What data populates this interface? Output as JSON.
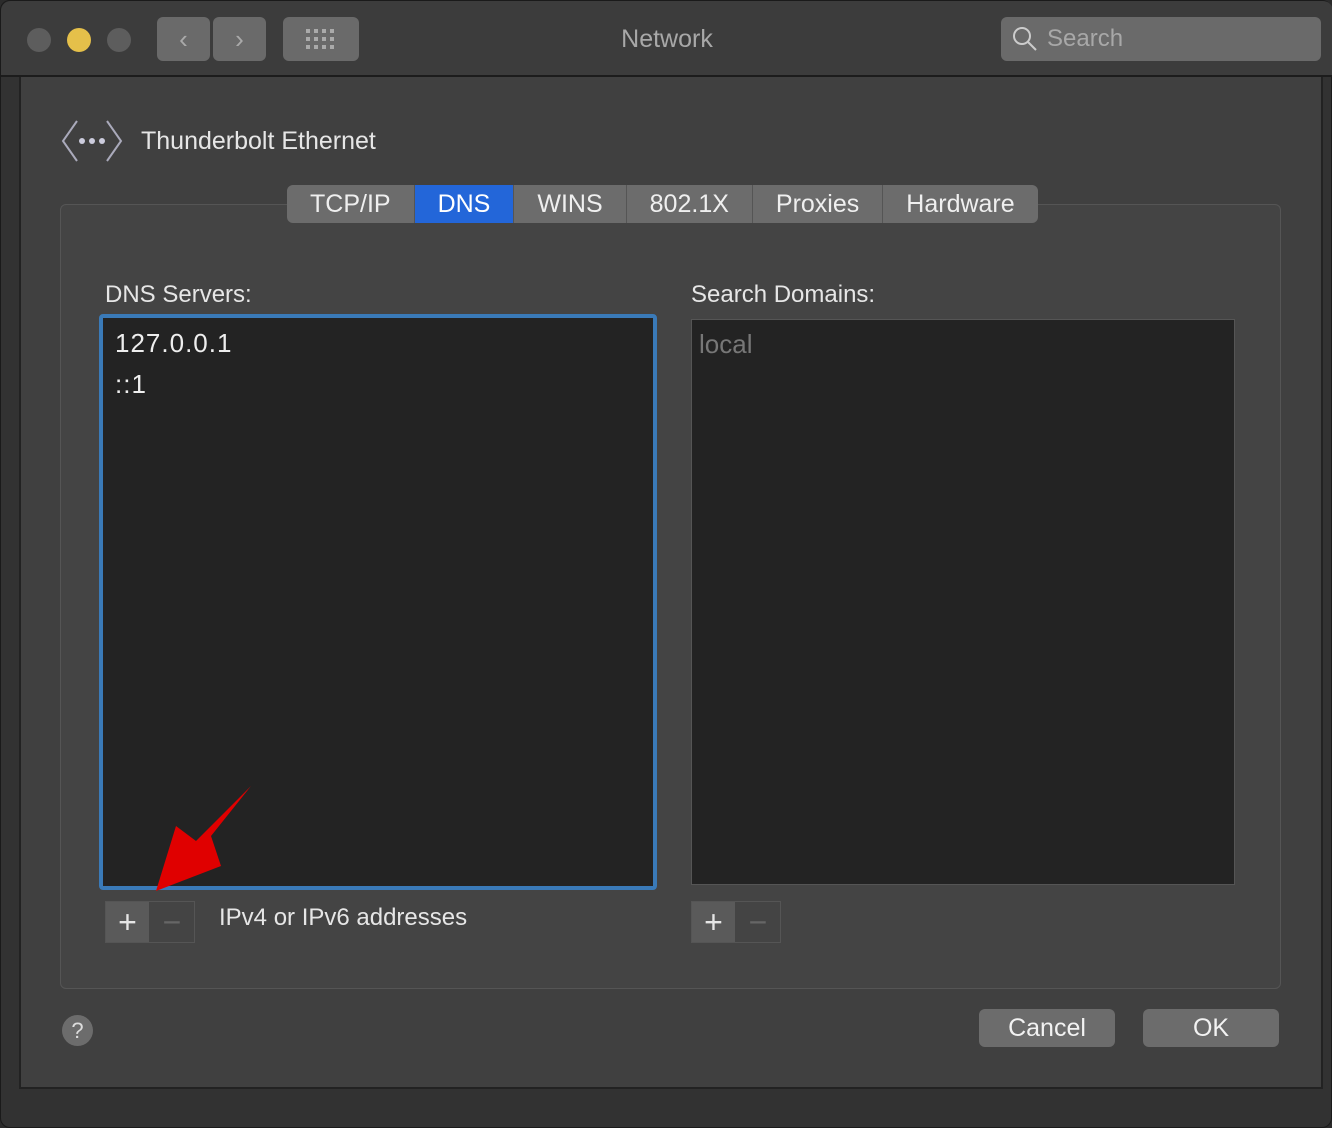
{
  "window": {
    "title": "Network",
    "search_placeholder": "Search"
  },
  "header": {
    "title": "Thunderbolt Ethernet",
    "icon": "network-ethernet-icon"
  },
  "tabs": [
    {
      "label": "TCP/IP"
    },
    {
      "label": "DNS",
      "active": true
    },
    {
      "label": "WINS"
    },
    {
      "label": "802.1X"
    },
    {
      "label": "Proxies"
    },
    {
      "label": "Hardware"
    }
  ],
  "dns": {
    "label": "DNS Servers:",
    "servers": [
      "127.0.0.1",
      "::1"
    ],
    "hint": "IPv4 or IPv6 addresses"
  },
  "domains": {
    "label": "Search Domains:",
    "items": [
      "local"
    ]
  },
  "buttons": {
    "cancel": "Cancel",
    "ok": "OK",
    "help": "?",
    "add": "+",
    "remove": "−"
  },
  "colors": {
    "accent": "#2366d9",
    "focus_ring": "#3a7ab8",
    "annotation_arrow": "#e00000",
    "minimize": "#e5c04a"
  }
}
